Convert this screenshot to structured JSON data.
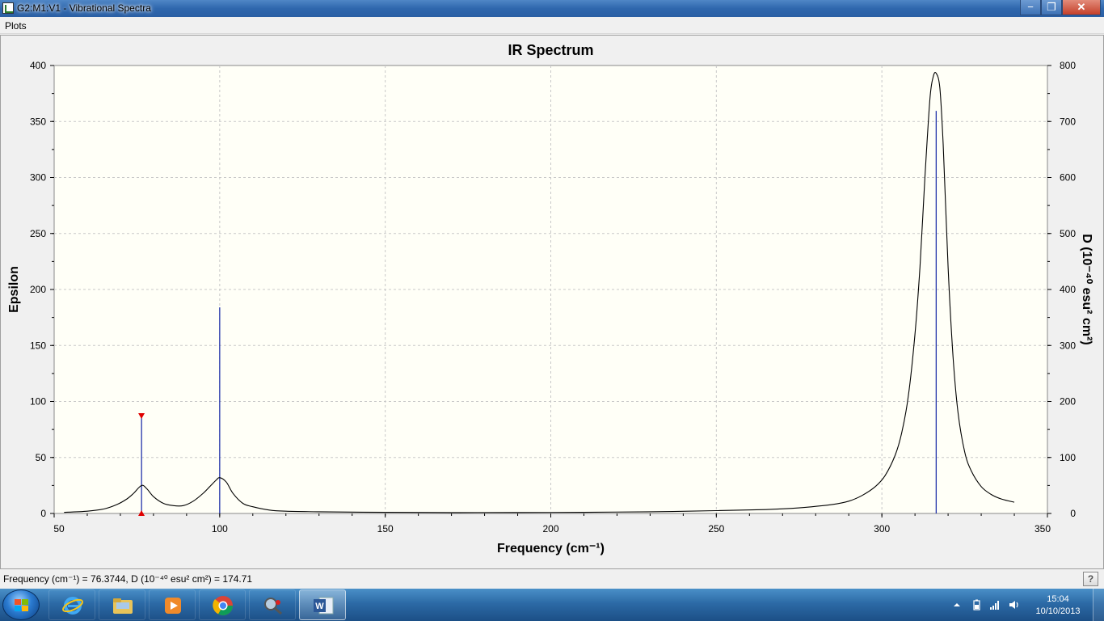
{
  "window": {
    "title": "G2:M1:V1 - Vibrational Spectra",
    "minimize_label": "−",
    "maximize_label": "❐",
    "close_label": "✕"
  },
  "menu": {
    "items": [
      {
        "label": "Plots"
      }
    ]
  },
  "status": {
    "readout": "Frequency (cm⁻¹) = 76.3744, D (10⁻⁴⁰ esu² cm²) = 174.71",
    "help_label": "?"
  },
  "taskbar": {
    "apps": [
      {
        "name": "internet-explorer",
        "icon": "ie-icon"
      },
      {
        "name": "file-explorer",
        "icon": "folder-icon"
      },
      {
        "name": "media-player",
        "icon": "media-player-icon"
      },
      {
        "name": "chrome",
        "icon": "chrome-icon"
      },
      {
        "name": "gaussview",
        "icon": "gaussview-icon"
      },
      {
        "name": "word",
        "icon": "word-icon"
      }
    ],
    "time": "15:04",
    "date": "10/10/2013"
  },
  "chart_data": {
    "type": "line",
    "title": "IR Spectrum",
    "xlabel": "Frequency (cm⁻¹)",
    "ylabel": "Epsilon",
    "y2label": "D (10⁻⁴⁰ esu² cm²)",
    "xlim": [
      50,
      350
    ],
    "ylim": [
      0,
      400
    ],
    "y2lim": [
      0,
      800
    ],
    "xticks": [
      50,
      100,
      150,
      200,
      250,
      300,
      350
    ],
    "yticks": [
      0,
      50,
      100,
      150,
      200,
      250,
      300,
      350,
      400
    ],
    "y2ticks": [
      0,
      100,
      200,
      300,
      400,
      500,
      600,
      700,
      800
    ],
    "grid": true,
    "series": [
      {
        "kind": "spectrum",
        "x": [
          53,
          60,
          65,
          69,
          72,
          74,
          76.4,
          78,
          80,
          83,
          86,
          89,
          92,
          95,
          97,
          99,
          100,
          102,
          104,
          107,
          110,
          115,
          120,
          130,
          150,
          170,
          190,
          210,
          230,
          250,
          265,
          275,
          285,
          290,
          294,
          298,
          301,
          304,
          306,
          308,
          310,
          311.5,
          313,
          314.5,
          315.5,
          316.4,
          317.5,
          318.5,
          320,
          321.5,
          323,
          325,
          327,
          330,
          333,
          336,
          340
        ],
        "y": [
          1,
          2,
          4,
          8,
          13,
          18,
          25,
          22,
          15,
          9,
          7,
          7,
          11,
          18,
          24,
          30,
          32,
          28,
          18,
          9,
          6,
          3,
          2,
          1.5,
          1,
          0.8,
          0.9,
          1,
          1.5,
          2.5,
          3.5,
          5,
          8,
          11,
          16,
          24,
          34,
          52,
          72,
          105,
          160,
          220,
          300,
          370,
          390,
          393,
          380,
          330,
          220,
          140,
          90,
          55,
          38,
          24,
          17,
          13,
          10
        ]
      },
      {
        "kind": "sticks",
        "x": [
          76.4,
          100,
          316.4
        ],
        "y2": [
          174.71,
          368,
          719
        ]
      }
    ],
    "selected": {
      "x": 76.3744,
      "y2": 174.71
    }
  }
}
